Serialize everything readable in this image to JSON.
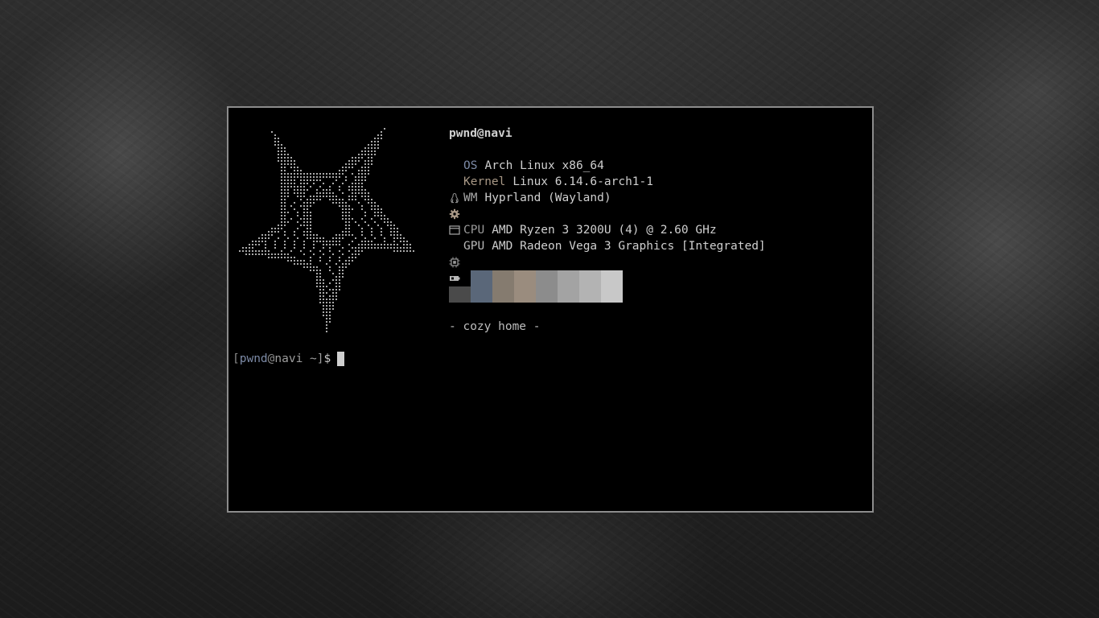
{
  "terminal": {
    "user_host": "pwnd@navi",
    "info": [
      {
        "icon": "linux-icon",
        "key": "OS",
        "value": "Arch Linux x86_64",
        "key_color": "#7c8aa6"
      },
      {
        "icon": "gear-icon",
        "key": "Kernel",
        "value": "Linux 6.14.6-arch1-1",
        "key_color": "#a89886"
      },
      {
        "icon": "window-icon",
        "key": "WM",
        "value": "Hyprland (Wayland)",
        "key_color": "#a8a8a8"
      },
      {
        "icon": "cpu-icon",
        "key": "CPU",
        "value": "AMD Ryzen 3 3200U (4) @ 2.60 GHz",
        "key_color": "#9a9a9a"
      },
      {
        "icon": "gpu-icon",
        "key": "GPU",
        "value": "AMD Radeon Vega 3 Graphics [Integrated]",
        "key_color": "#b8b8b8"
      }
    ],
    "palette": [
      "#4a4a4a",
      "#5a6779",
      "#857b6f",
      "#9a8c7e",
      "#8c8c8c",
      "#a3a3a3",
      "#b3b3b3",
      "#c8c8c8"
    ],
    "motto": "- cozy home -",
    "prompt": {
      "open_bracket": "[",
      "user": "pwnd",
      "at": "@",
      "host": "navi",
      "dir": " ~]",
      "symbol": "$"
    }
  },
  "colors": {
    "terminal_bg": "#000000",
    "terminal_border": "#8c8c8c",
    "text": "#c9c9c9"
  }
}
